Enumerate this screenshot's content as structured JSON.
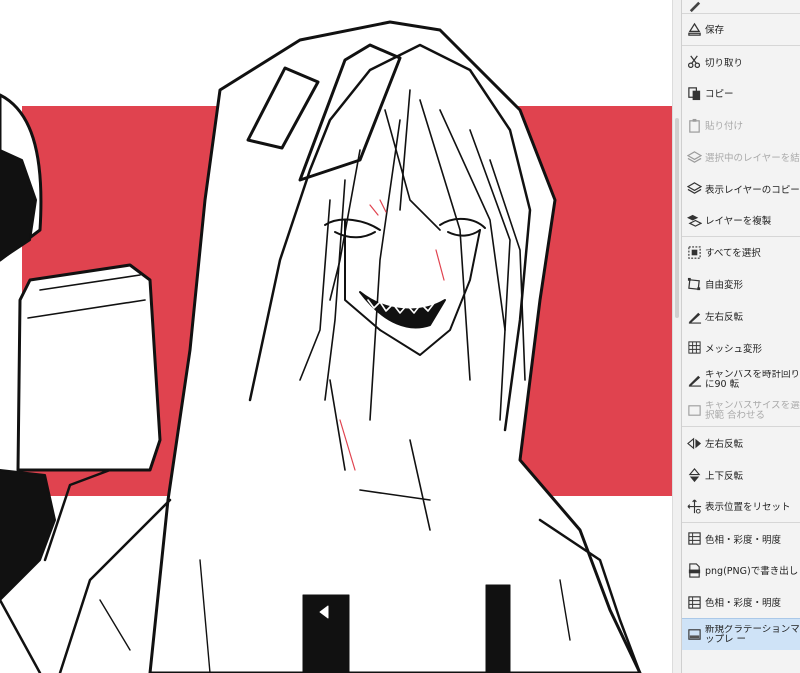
{
  "canvas": {
    "background_color": "#ffffff",
    "accent_color": "#e0434f",
    "line_color": "#111111"
  },
  "command_bar": {
    "items": [
      {
        "label": "",
        "icon": "edit-icon",
        "enabled": true
      },
      {
        "label": "保存",
        "icon": "save-icon",
        "enabled": true
      },
      {
        "label": "切り取り",
        "icon": "scissors-icon",
        "enabled": true
      },
      {
        "label": "コピー",
        "icon": "copy-icon",
        "enabled": true
      },
      {
        "label": "貼り付け",
        "icon": "paste-icon",
        "enabled": false
      },
      {
        "label": "選択中のレイヤーを結合",
        "icon": "merge-layers-icon",
        "enabled": false
      },
      {
        "label": "表示レイヤーのコピーを結",
        "icon": "merge-visible-icon",
        "enabled": true
      },
      {
        "label": "レイヤーを複製",
        "icon": "duplicate-layer-icon",
        "enabled": true
      },
      {
        "label": "すべてを選択",
        "icon": "select-all-icon",
        "enabled": true
      },
      {
        "label": "自由変形",
        "icon": "free-transform-icon",
        "enabled": true
      },
      {
        "label": "左右反転",
        "icon": "flip-icon",
        "enabled": true
      },
      {
        "label": "メッシュ変形",
        "icon": "mesh-transform-icon",
        "enabled": true
      },
      {
        "label": "キャンバスを時計回りに90 転",
        "icon": "rotate-canvas-icon",
        "enabled": true
      },
      {
        "label": "キャンバスサイズを選択範 合わせる",
        "icon": "canvas-size-icon",
        "enabled": false
      },
      {
        "label": "左右反転",
        "icon": "flip-horizontal-icon",
        "enabled": true
      },
      {
        "label": "上下反転",
        "icon": "flip-vertical-icon",
        "enabled": true
      },
      {
        "label": "表示位置をリセット",
        "icon": "reset-view-icon",
        "enabled": true
      },
      {
        "label": "色相・彩度・明度",
        "icon": "hue-saturation-icon",
        "enabled": true
      },
      {
        "label": "png(PNG)で書き出し",
        "icon": "png-export-icon",
        "enabled": true
      },
      {
        "label": "色相・彩度・明度",
        "icon": "hue-saturation-icon",
        "enabled": true
      },
      {
        "label": "新規グラデーションマップレ ー",
        "icon": "gradient-map-icon",
        "enabled": true,
        "selected": true
      }
    ]
  }
}
